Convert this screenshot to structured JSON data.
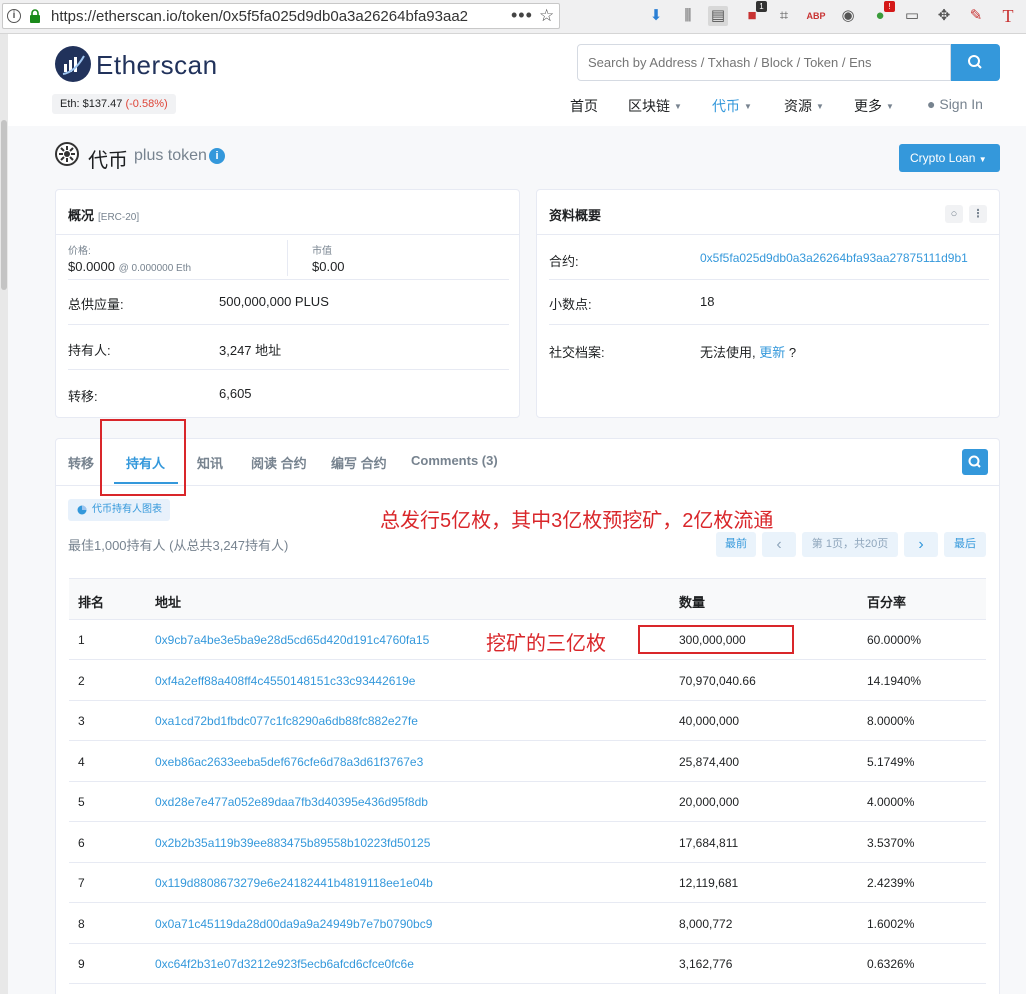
{
  "browser": {
    "url": "https://etherscan.io/token/0x5f5fa025d9db0a3a26264bfa93aa2",
    "badge_one": "1",
    "badge_alert": "!"
  },
  "header": {
    "logo": "Etherscan",
    "eth_price_label": "Eth: $137.47",
    "eth_price_change": "(-0.58%)",
    "search_placeholder": "Search by Address / Txhash / Block / Token / Ens",
    "nav": [
      "首页",
      "区块链",
      "代币",
      "资源",
      "更多"
    ],
    "sign_in": "Sign In"
  },
  "token": {
    "title": "代币",
    "name": "plus token",
    "crypto_loan": "Crypto Loan"
  },
  "overview": {
    "title": "概况",
    "standard": "[ERC-20]",
    "price_label": "价格:",
    "price_value": "$0.0000",
    "price_eth": "@ 0.000000 Eth",
    "market_label": "市值",
    "market_value": "$0.00",
    "supply_label": "总供应量:",
    "supply_value": "500,000,000 PLUS",
    "holders_label": "持有人:",
    "holders_value": "3,247 地址",
    "transfers_label": "转移:",
    "transfers_value": "6,605"
  },
  "profile": {
    "title": "资料概要",
    "contract_label": "合约:",
    "contract_value": "0x5f5fa025d9db0a3a26264bfa93aa27875111d9b1",
    "decimals_label": "小数点:",
    "decimals_value": "18",
    "social_label": "社交档案:",
    "social_value": "无法使用,",
    "social_link": "更新",
    "social_q": "?"
  },
  "tabs": [
    "转移",
    "持有人",
    "知讯",
    "阅读 合约",
    "编写 合约",
    "Comments (3)"
  ],
  "holders": {
    "chart_chip": "代币持有人图表",
    "summary": "最佳1,000持有人 (从总共3,247持有人)",
    "pager": {
      "first": "最前",
      "prev": "‹",
      "page": "第 1页，共20页",
      "next": "›",
      "last": "最后"
    },
    "columns": [
      "排名",
      "地址",
      "数量",
      "百分率"
    ],
    "rows": [
      {
        "rank": "1",
        "address": "0x9cb7a4be3e5ba9e28d5cd65d420d191c4760fa15",
        "qty": "300,000,000",
        "pct": "60.0000%"
      },
      {
        "rank": "2",
        "address": "0xf4a2eff88a408ff4c4550148151c33c93442619e",
        "qty": "70,970,040.66",
        "pct": "14.1940%"
      },
      {
        "rank": "3",
        "address": "0xa1cd72bd1fbdc077c1fc8290a6db88fc882e27fe",
        "qty": "40,000,000",
        "pct": "8.0000%"
      },
      {
        "rank": "4",
        "address": "0xeb86ac2633eeba5def676cfe6d78a3d61f3767e3",
        "qty": "25,874,400",
        "pct": "5.1749%"
      },
      {
        "rank": "5",
        "address": "0xd28e7e477a052e89daa7fb3d40395e436d95f8db",
        "qty": "20,000,000",
        "pct": "4.0000%"
      },
      {
        "rank": "6",
        "address": "0x2b2b35a119b39ee883475b89558b10223fd50125",
        "qty": "17,684,811",
        "pct": "3.5370%"
      },
      {
        "rank": "7",
        "address": "0x119d8808673279e6e24182441b4819118ee1e04b",
        "qty": "12,119,681",
        "pct": "2.4239%"
      },
      {
        "rank": "8",
        "address": "0x0a71c45119da28d00da9a9a24949b7e7b0790bc9",
        "qty": "8,000,772",
        "pct": "1.6002%"
      },
      {
        "rank": "9",
        "address": "0xc64f2b31e07d3212e923f5ecb6afcd6cfce0fc6e",
        "qty": "3,162,776",
        "pct": "0.6326%"
      }
    ]
  },
  "annotations": {
    "total_note": "总发行5亿枚，其中3亿枚预挖矿，2亿枚流通",
    "mined_note": "挖矿的三亿枚"
  },
  "colors": {
    "accent": "#3498db",
    "annotation": "#d9262a",
    "brand": "#21325b"
  }
}
